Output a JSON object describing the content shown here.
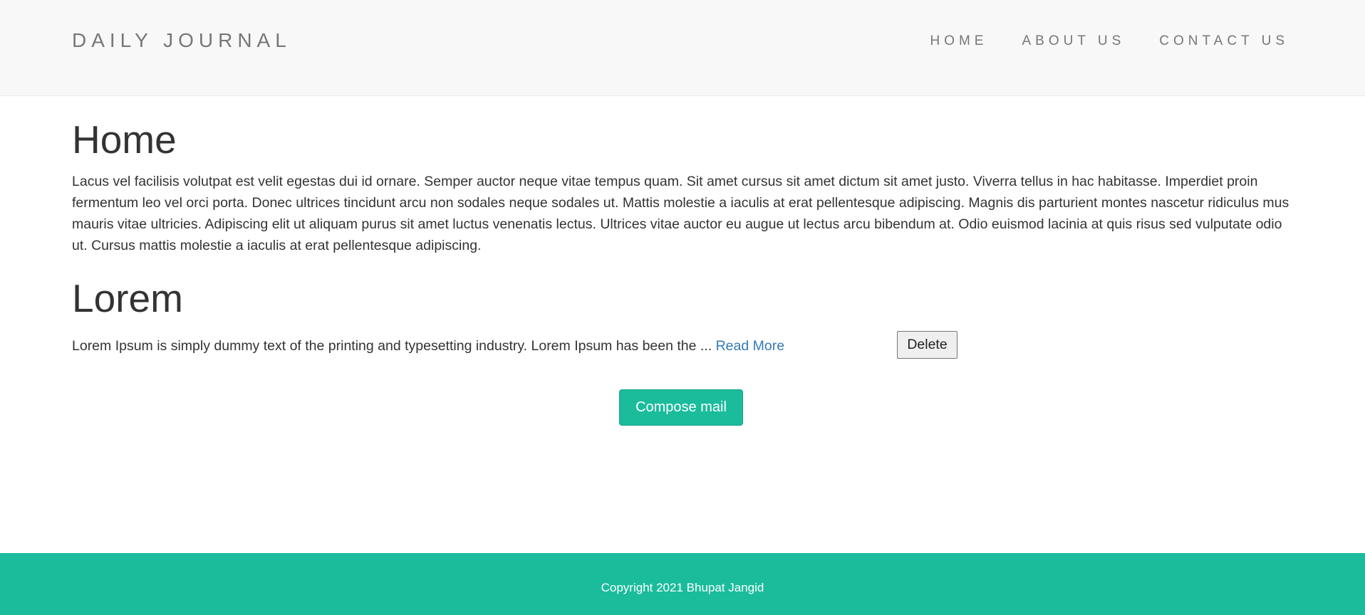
{
  "navbar": {
    "brand": "DAILY JOURNAL",
    "links": [
      {
        "label": "HOME"
      },
      {
        "label": "ABOUT US"
      },
      {
        "label": "CONTACT US"
      }
    ]
  },
  "home": {
    "title": "Home",
    "text": "Lacus vel facilisis volutpat est velit egestas dui id ornare. Semper auctor neque vitae tempus quam. Sit amet cursus sit amet dictum sit amet justo. Viverra tellus in hac habitasse. Imperdiet proin fermentum leo vel orci porta. Donec ultrices tincidunt arcu non sodales neque sodales ut. Mattis molestie a iaculis at erat pellentesque adipiscing. Magnis dis parturient montes nascetur ridiculus mus mauris vitae ultricies. Adipiscing elit ut aliquam purus sit amet luctus venenatis lectus. Ultrices vitae auctor eu augue ut lectus arcu bibendum at. Odio euismod lacinia at quis risus sed vulputate odio ut. Cursus mattis molestie a iaculis at erat pellentesque adipiscing."
  },
  "posts": [
    {
      "title": "Lorem",
      "excerpt": "Lorem Ipsum is simply dummy text of the printing and typesetting industry. Lorem Ipsum has been the ...",
      "read_more_label": "Read More",
      "delete_label": "Delete"
    }
  ],
  "actions": {
    "compose_label": "Compose mail"
  },
  "footer": {
    "copyright": "Copyright 2021 Bhupat Jangid"
  },
  "colors": {
    "accent": "#1abc9c",
    "link": "#337ab7",
    "navbar_bg": "#f8f8f8",
    "nav_text": "#777777"
  }
}
